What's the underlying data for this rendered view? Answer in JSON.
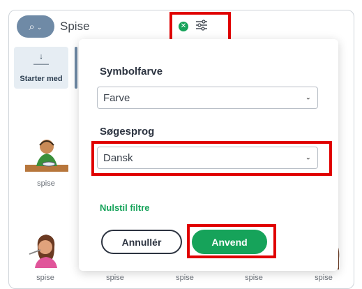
{
  "search": {
    "query": "Spise",
    "clear_icon": "close-circle-icon",
    "filter_icon": "sliders-icon"
  },
  "sidebar": {
    "tab_label": "Starter med",
    "tab_icon": "starts-with-icon"
  },
  "symbols": [
    {
      "label": "spise"
    },
    {
      "label": "spise"
    },
    {
      "label": "spise"
    },
    {
      "label": "spise"
    },
    {
      "label": "spise"
    },
    {
      "label": "spise"
    }
  ],
  "filter_panel": {
    "symbol_color_label": "Symbolfarve",
    "symbol_color_value": "Farve",
    "search_language_label": "Søgesprog",
    "search_language_value": "Dansk",
    "reset_label": "Nulstil filtre",
    "cancel_label": "Annullér",
    "apply_label": "Anvend"
  },
  "colors": {
    "accent_green": "#16a35a",
    "highlight_red": "#e00000",
    "search_blue": "#6f8aa6"
  }
}
